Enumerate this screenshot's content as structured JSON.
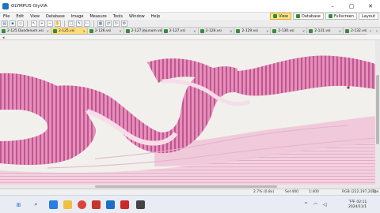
{
  "window": {
    "title": "OLYMPUS OlyVIA"
  },
  "window_controls": {
    "minimize": "–",
    "maximize": "▢",
    "close": "✕"
  },
  "menu": [
    "File",
    "Edit",
    "View",
    "Database",
    "Image",
    "Measure",
    "Tools",
    "Window",
    "Help"
  ],
  "modes": {
    "view": "View",
    "database": "Database",
    "fullscreen": "Fullscreen",
    "layout": "Layout"
  },
  "tabs": [
    {
      "label": "2-125 Duodenum.vsi",
      "active": false
    },
    {
      "label": "2-125.vsi",
      "active": true
    },
    {
      "label": "2-126.vsi",
      "active": false
    },
    {
      "label": "2-127 Jejunum.vsi",
      "active": false
    },
    {
      "label": "2-127.vsi",
      "active": false
    },
    {
      "label": "2-128.vsi",
      "active": false
    },
    {
      "label": "2-129.vsi",
      "active": false
    },
    {
      "label": "2-130.vsi",
      "active": false
    },
    {
      "label": "2-131.vsi",
      "active": false
    },
    {
      "label": "2-132.vsi",
      "active": false
    }
  ],
  "status": {
    "zoom": "2.7% (0.8x)",
    "sel": "Sel:400",
    "scale": "1:400",
    "rgb": "RGB (222,197,207)",
    "px": "1px"
  },
  "clock": {
    "ampm": "下午 02:11",
    "date": "2024/11/1"
  },
  "colors": {
    "tissue_pink": "#c8609a",
    "tissue_light": "#efc5d8",
    "background": "#f1f0ec",
    "active_tab": "#ffdd7a"
  }
}
